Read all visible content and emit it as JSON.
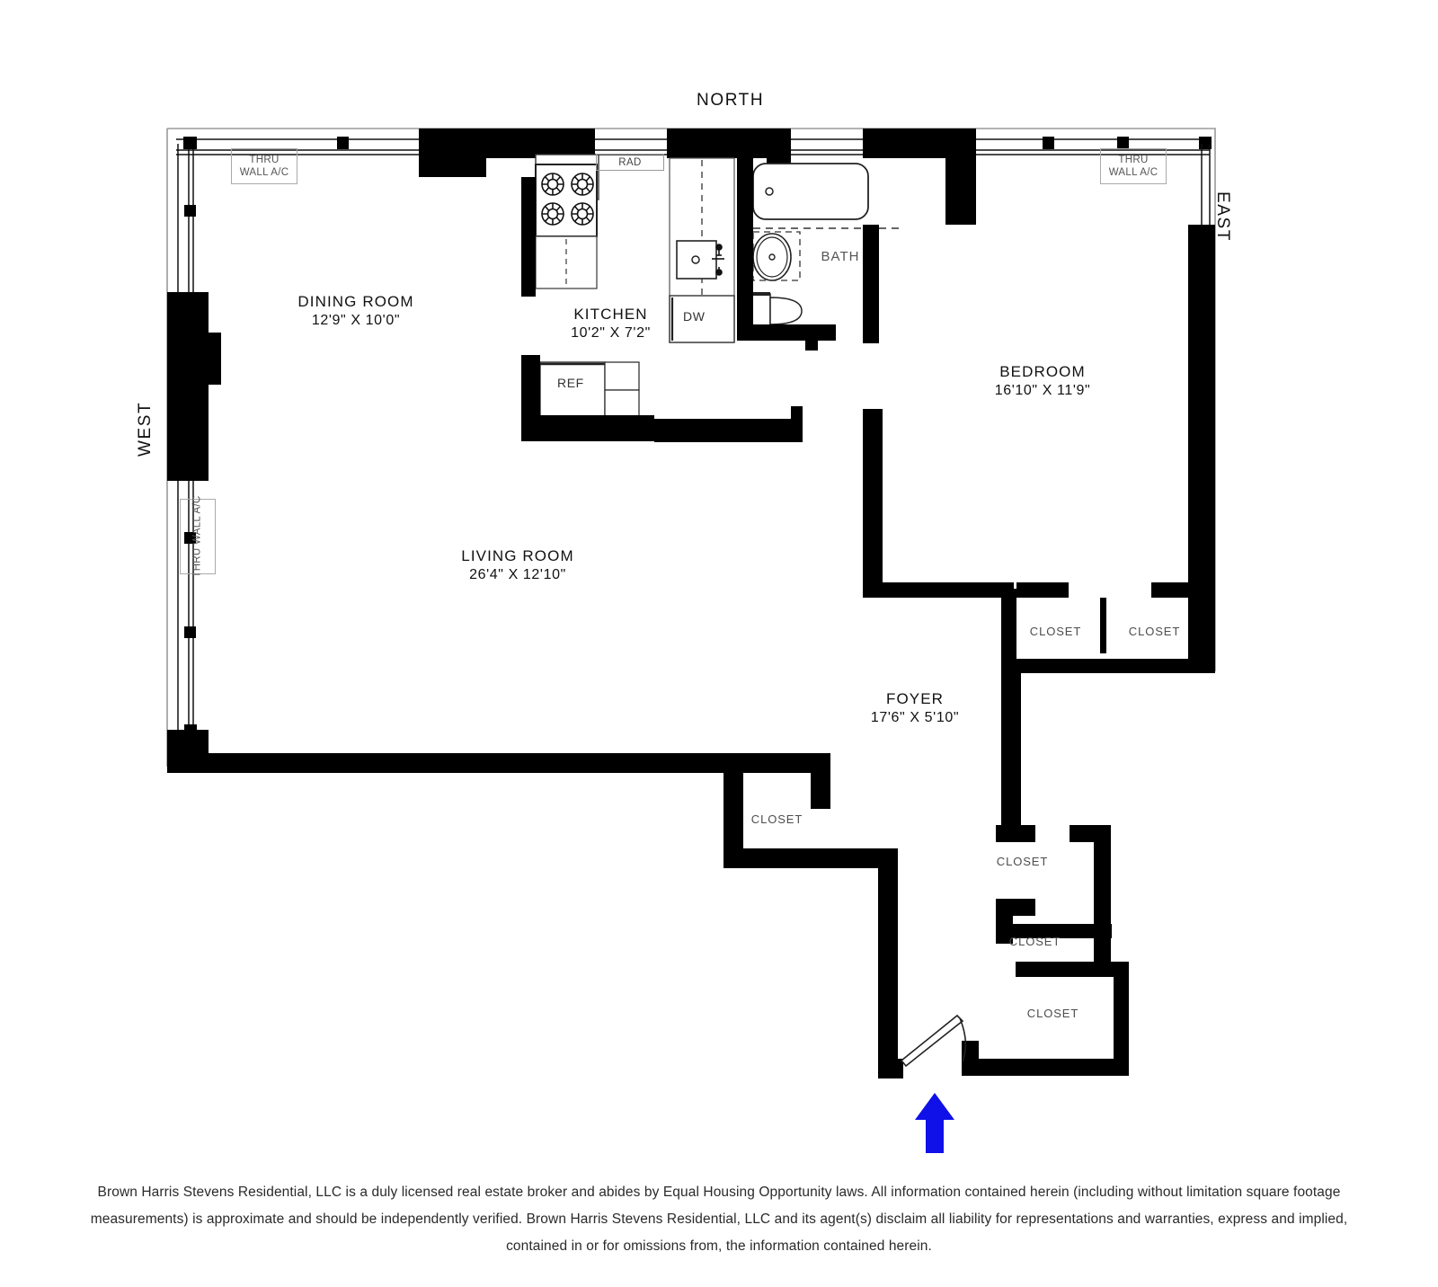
{
  "compass": {
    "north": "NORTH",
    "east": "EAST",
    "west": "WEST"
  },
  "rooms": [
    {
      "id": "dining-room",
      "name": "DINING ROOM",
      "dimensions": "12'9\" X 10'0\""
    },
    {
      "id": "kitchen",
      "name": "KITCHEN",
      "dimensions": "10'2\" X 7'2\""
    },
    {
      "id": "bath",
      "name": "BATH",
      "dimensions": ""
    },
    {
      "id": "bedroom",
      "name": "BEDROOM",
      "dimensions": "16'10\" X 11'9\""
    },
    {
      "id": "living-room",
      "name": "LIVING ROOM",
      "dimensions": "26'4\" X 12'10\""
    },
    {
      "id": "foyer",
      "name": "FOYER",
      "dimensions": "17'6\" X 5'10\""
    }
  ],
  "closets": [
    {
      "id": "closet-bedroom-left",
      "name": "CLOSET"
    },
    {
      "id": "closet-bedroom-right",
      "name": "CLOSET"
    },
    {
      "id": "closet-living",
      "name": "CLOSET"
    },
    {
      "id": "closet-foyer-upper",
      "name": "CLOSET"
    },
    {
      "id": "closet-foyer-middle",
      "name": "CLOSET"
    },
    {
      "id": "closet-foyer-lower",
      "name": "CLOSET"
    }
  ],
  "annotations": {
    "thru_wall_ac_line1": "THRU",
    "thru_wall_ac_line2": "WALL A/C",
    "thru_wall_ac_vertical": "THRU WALL A/C",
    "radiator": "RAD",
    "refrigerator": "REF",
    "dishwasher": "DW"
  },
  "colors": {
    "wall": "#000000",
    "window_frame": "#1a1a1a",
    "entry_arrow": "#1010e8",
    "label_gray": "#555555",
    "paper": "#ffffff"
  },
  "entry": {
    "arrow_direction": "up",
    "arrow_label": "entry-direction-arrow"
  },
  "disclaimer": {
    "text": "Brown Harris Stevens Residential, LLC is a duly licensed real estate broker and abides by Equal Housing Opportunity laws. All information contained herein (including without limitation square footage measurements) is approximate and should be independently verified. Brown Harris Stevens Residential, LLC and its agent(s) disclaim all liability for representations and warranties, express and implied, contained in or for omissions from, the information contained herein."
  }
}
